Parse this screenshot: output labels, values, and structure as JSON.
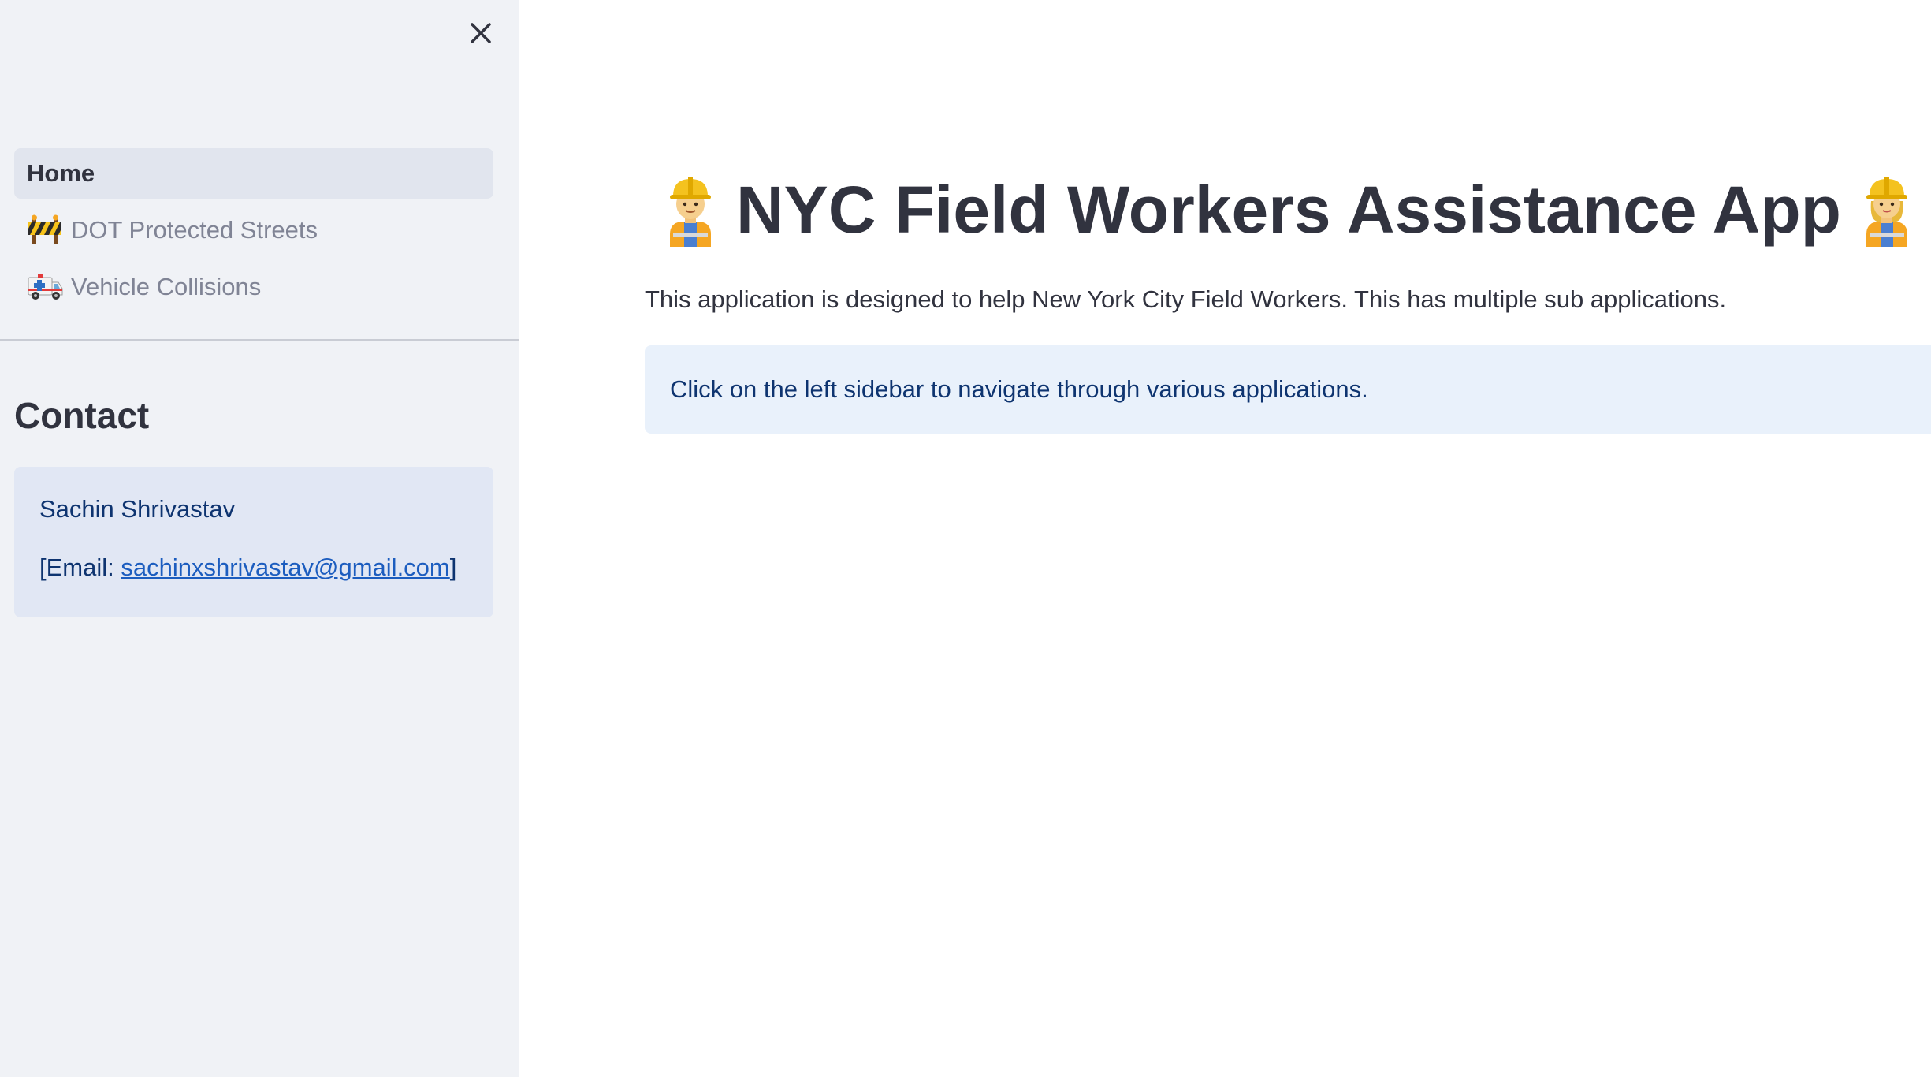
{
  "sidebar": {
    "close_icon": "close-icon",
    "nav_items": [
      {
        "label": "Home",
        "icon": "",
        "active": true
      },
      {
        "label": "DOT Protected Streets",
        "icon": "construction-barrier-icon",
        "active": false
      },
      {
        "label": "Vehicle Collisions",
        "icon": "ambulance-icon",
        "active": false
      }
    ],
    "contact": {
      "heading": "Contact",
      "name": "Sachin Shrivastav",
      "email_prefix": "[Email: ",
      "email": "sachinxshrivastav@gmail.com",
      "email_suffix": "]"
    }
  },
  "main": {
    "title": "NYC Field Workers Assistance App",
    "title_icons": [
      "construction-worker-man-icon",
      "construction-worker-woman-icon"
    ],
    "description": "This application is designed to help New York City Field Workers. This has multiple sub applications.",
    "info_message": "Click on the left sidebar to navigate through various applications."
  },
  "colors": {
    "sidebar_bg": "#f0f2f6",
    "active_nav_bg": "#e1e5ee",
    "info_bg": "#e9f1fb",
    "info_text": "#0e3470",
    "link": "#1c5dbf",
    "text": "#31333f"
  }
}
